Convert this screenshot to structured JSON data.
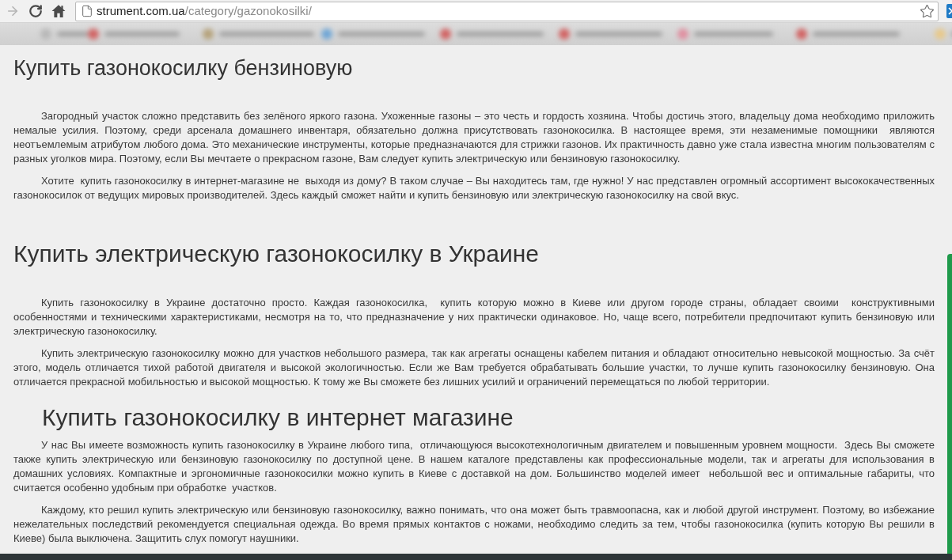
{
  "browser": {
    "nav_buttons": [
      {
        "kind": "forward",
        "disabled": true
      },
      {
        "kind": "reload",
        "disabled": false
      },
      {
        "kind": "home",
        "disabled": false
      }
    ],
    "address": {
      "domain": "strument.com.ua",
      "path": "/category/gazonokosilki/"
    },
    "bookmarked": false
  },
  "content": [
    {
      "kind": "heading1",
      "text": "Купить газонокосилку бензиновую"
    },
    {
      "kind": "paragraph",
      "text": "Загородный участок сложно представить без зелёного яркого газона. Ухоженные газоны – это честь и гордость хозяина. Чтобы достичь этого, владельцу дома необходимо приложить немалые усилия. Поэтому, среди арсенала домашнего инвентаря, обязательно должна присутствовать газонокосилка. В настоящее время, эти незаменимые помощники  являются неотъемлемым атрибутом любого дома. Это механические инструменты, которые предназначаются для стрижки газонов. Их практичность давно уже стала известна многим пользователям с разных уголков мира. Поэтому, если Вы мечтаете о прекрасном газоне, Вам следует купить электрическую или бензиновую газонокосилку."
    },
    {
      "kind": "paragraph",
      "text": "Хотите  купить газонокосилку в интернет-магазине не  выходя из дому? В таком случае – Вы находитесь там, где нужно! У нас представлен огромный ассортимент высококачественных газонокосилок от ведущих мировых производителей. Здесь каждый сможет найти и купить бензиновую или электрическую газонокосилку на свой вкус."
    },
    {
      "kind": "heading2",
      "text": "Купить электрическую газонокосилку в Украине"
    },
    {
      "kind": "paragraph",
      "text": "Купить газонокосилку в Украине достаточно просто. Каждая газонокосилка,  купить которую можно в Киеве или другом городе страны, обладает своими  конструктивными особенностями и техническими характеристиками, несмотря на то, что предназначение у них практически одинаковое. Но, чаще всего, потребители предпочитают купить бензиновую или электрическую газонокосилку."
    },
    {
      "kind": "paragraph",
      "text": "Купить электрическую газонокосилку можно для участков небольшого размера, так как агрегаты оснащены кабелем питания и обладают относительно невысокой мощностью. За счёт этого, модель отличается тихой работой двигателя и высокой экологичностью. Если же Вам требуется обрабатывать большие участки, то лучше купить газонокосилку бензиновую. Она отличается прекрасной мобильностью и высокой мощностью. К тому же Вы сможете без лишних усилий и ограничений перемещаться по любой территории."
    },
    {
      "kind": "heading3",
      "text": "Купить газонокосилку в интернет магазине"
    },
    {
      "kind": "paragraph",
      "text": "У нас Вы имеете возможность купить газонокосилку в Украине любого типа,  отличающуюся высокотехнологичным двигателем и повышенным уровнем мощности.  Здесь Вы сможете также купить электрическую или бензиновую газонокосилку по доступной цене. В нашем каталоге представлены как профессиональные модели, так и агрегаты для использования в домашних условиях. Компактные и эргономичные газонокосилки можно купить в Киеве с доставкой на дом. Большинство моделей имеет  небольшой вес и оптимальные габариты, что считается особенно удобным при обработке  участков."
    },
    {
      "kind": "paragraph",
      "text": "Каждому, кто решил купить электрическую или бензиновую газонокосилку, важно понимать, что она может быть травмоопасна, как и любой другой инструмент. Поэтому, во избежание нежелательных последствий рекомендуется специальная одежда. Во время прямых контактов с ножами, необходимо следить за тем, чтобы газонокосилка (купить которую Вы решили в Киеве) была выключена. Защитить слух помогут наушники."
    }
  ]
}
